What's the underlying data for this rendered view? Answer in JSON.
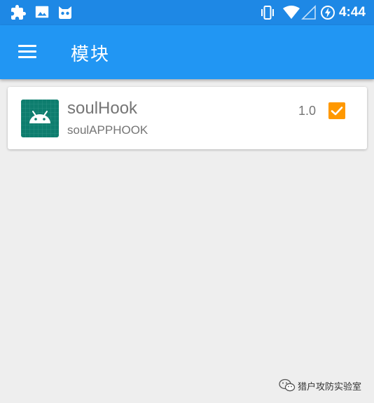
{
  "status_bar": {
    "time": "4:44",
    "left_icons": [
      "puzzle-icon",
      "image-icon",
      "cat-face-icon"
    ],
    "right_icons": [
      "vibrate-icon",
      "wifi-icon",
      "cellular-signal-icon",
      "battery-charging-icon"
    ]
  },
  "app_bar": {
    "title": "模块",
    "menu_icon": "hamburger-menu-icon",
    "color": "#2196f3"
  },
  "modules": [
    {
      "name": "soulHook",
      "description": "soulAPPHOOK",
      "version": "1.0",
      "enabled": true,
      "icon": "android-icon",
      "checkbox_color": "#ff9800"
    }
  ],
  "watermark": {
    "text": "猎户攻防实验室",
    "icon": "wechat-icon"
  },
  "colors": {
    "status_bar": "#1e88e5",
    "background": "#eeeeee",
    "icon_bg": "#0e7d6e"
  }
}
